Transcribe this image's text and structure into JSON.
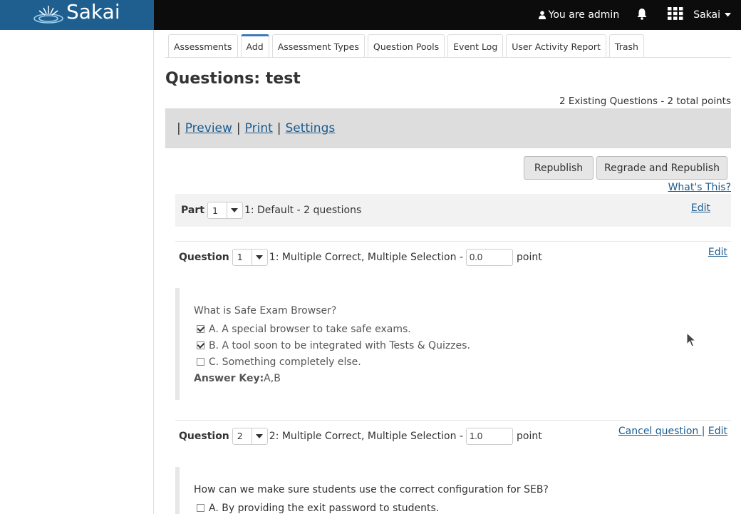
{
  "brand": {
    "logo_text": "Sakai"
  },
  "topnav": {
    "user_text": "You are admin",
    "site_label": "Sakai"
  },
  "tabs": [
    {
      "label": "Assessments"
    },
    {
      "label": "Add"
    },
    {
      "label": "Assessment Types"
    },
    {
      "label": "Question Pools"
    },
    {
      "label": "Event Log"
    },
    {
      "label": "User Activity Report"
    },
    {
      "label": "Trash"
    }
  ],
  "page": {
    "title": "Questions: test",
    "summary": "2 Existing Questions - 2 total points"
  },
  "actions": {
    "preview": "Preview",
    "print": "Print",
    "settings": "Settings",
    "separator": "|"
  },
  "buttons": {
    "republish": "Republish",
    "regrade": "Regrade and Republish",
    "whats_this": "What's This?"
  },
  "part": {
    "label": "Part",
    "selected": "1",
    "description": "1:  Default - 2 questions",
    "edit": "Edit"
  },
  "questions": [
    {
      "label": "Question",
      "selected": "1",
      "description": "1: Multiple Correct, Multiple Selection -",
      "points": "0.0",
      "points_unit": "point",
      "edit": "Edit",
      "text": "What is Safe Exam Browser?",
      "answers": [
        {
          "text": "A. A special browser to take safe exams.",
          "checked": true
        },
        {
          "text": "B. A tool soon to be integrated with Tests & Quizzes.",
          "checked": true
        },
        {
          "text": "C. Something completely else.",
          "checked": false
        }
      ],
      "answer_key_label": "Answer Key:",
      "answer_key": "A,B"
    },
    {
      "label": "Question",
      "selected": "2",
      "description": "2: Multiple Correct, Multiple Selection -",
      "points": "1.0",
      "points_unit": "point",
      "cancel": "Cancel question ",
      "separator": "|",
      "edit": "Edit",
      "text": "How can we make sure students use the correct configuration for SEB?",
      "answers": [
        {
          "text": "A. By providing the exit password to students.",
          "checked": false
        }
      ]
    }
  ]
}
